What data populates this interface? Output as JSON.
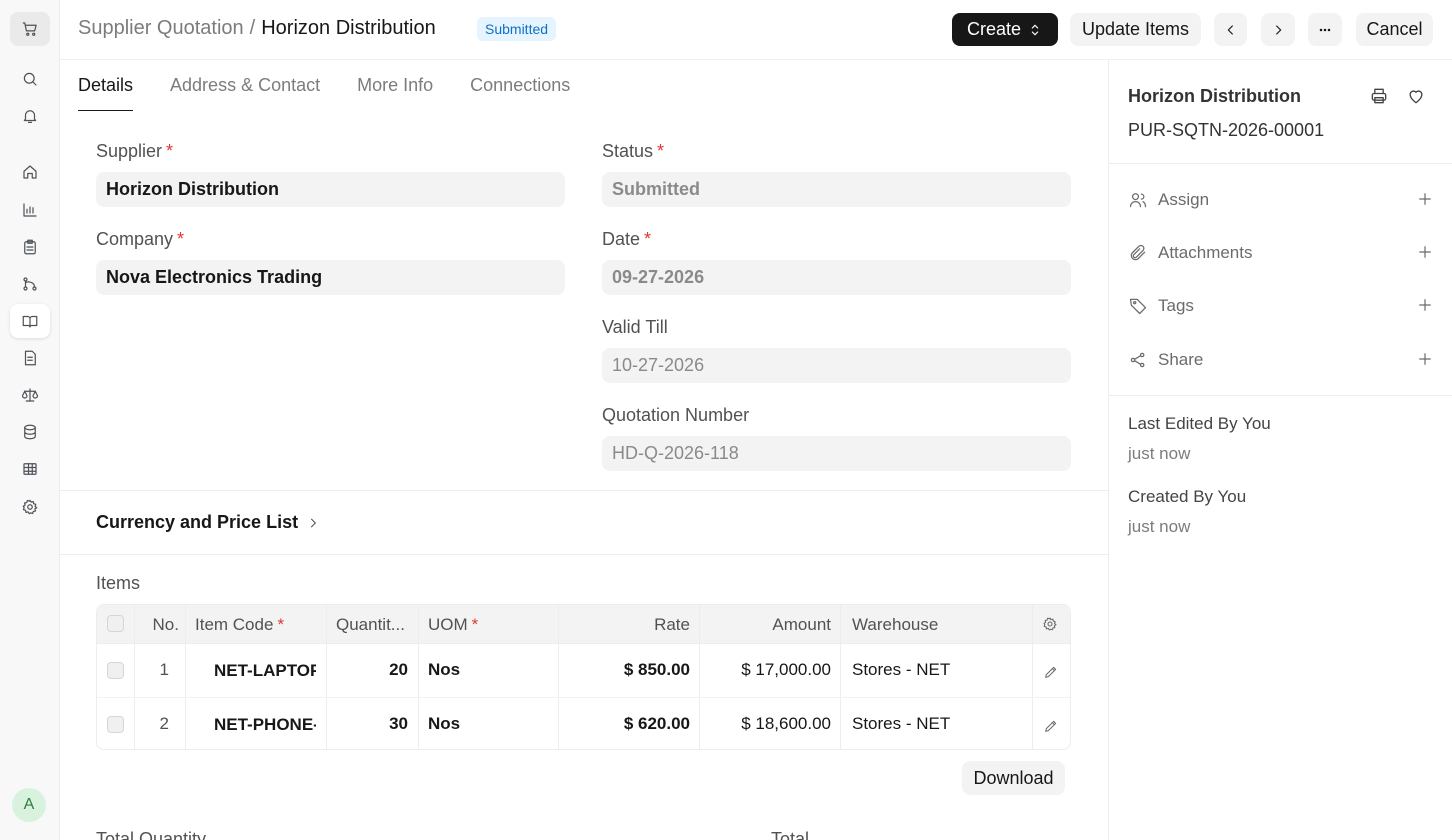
{
  "header": {
    "breadcrumb_parent": "Supplier Quotation",
    "breadcrumb_separator": "/",
    "breadcrumb_current": "Horizon Distribution",
    "status_badge": "Submitted",
    "create_label": "Create",
    "update_items_label": "Update Items",
    "cancel_label": "Cancel"
  },
  "tabs": [
    "Details",
    "Address & Contact",
    "More Info",
    "Connections"
  ],
  "form": {
    "supplier_label": "Supplier",
    "supplier_value": "Horizon Distribution",
    "company_label": "Company",
    "company_value": "Nova Electronics Trading",
    "status_label": "Status",
    "status_value": "Submitted",
    "date_label": "Date",
    "date_value": "09-27-2026",
    "valid_till_label": "Valid Till",
    "valid_till_value": "10-27-2026",
    "quotation_number_label": "Quotation Number",
    "quotation_number_value": "HD-Q-2026-118",
    "required_mark": "*",
    "currency_section": "Currency and Price List",
    "items_label": "Items",
    "download_label": "Download",
    "total_quantity_label": "Total Quantity",
    "total_label": "Total"
  },
  "items_table": {
    "columns": {
      "no": "No.",
      "item_code": "Item Code",
      "quantity": "Quantit...",
      "uom": "UOM",
      "rate": "Rate",
      "amount": "Amount",
      "warehouse": "Warehouse"
    },
    "rows": [
      {
        "no": "1",
        "item_code": "NET-LAPTOP",
        "quantity": "20",
        "uom": "Nos",
        "rate": "$ 850.00",
        "amount": "$ 17,000.00",
        "warehouse": "Stores - NET"
      },
      {
        "no": "2",
        "item_code": "NET-PHONE-",
        "quantity": "30",
        "uom": "Nos",
        "rate": "$ 620.00",
        "amount": "$ 18,600.00",
        "warehouse": "Stores - NET"
      }
    ]
  },
  "sidebar": {
    "title": "Horizon Distribution",
    "doc_id": "PUR-SQTN-2026-00001",
    "actions": [
      "Assign",
      "Attachments",
      "Tags",
      "Share"
    ],
    "last_edited_label": "Last Edited By You",
    "last_edited_value": "just now",
    "created_label": "Created By You",
    "created_value": "just now"
  },
  "user": {
    "avatar_initial": "A"
  },
  "colors": {
    "accent_dark": "#171717",
    "badge_bg": "#e6f4ff",
    "badge_text": "#0f6fc4",
    "required": "#e03636"
  }
}
